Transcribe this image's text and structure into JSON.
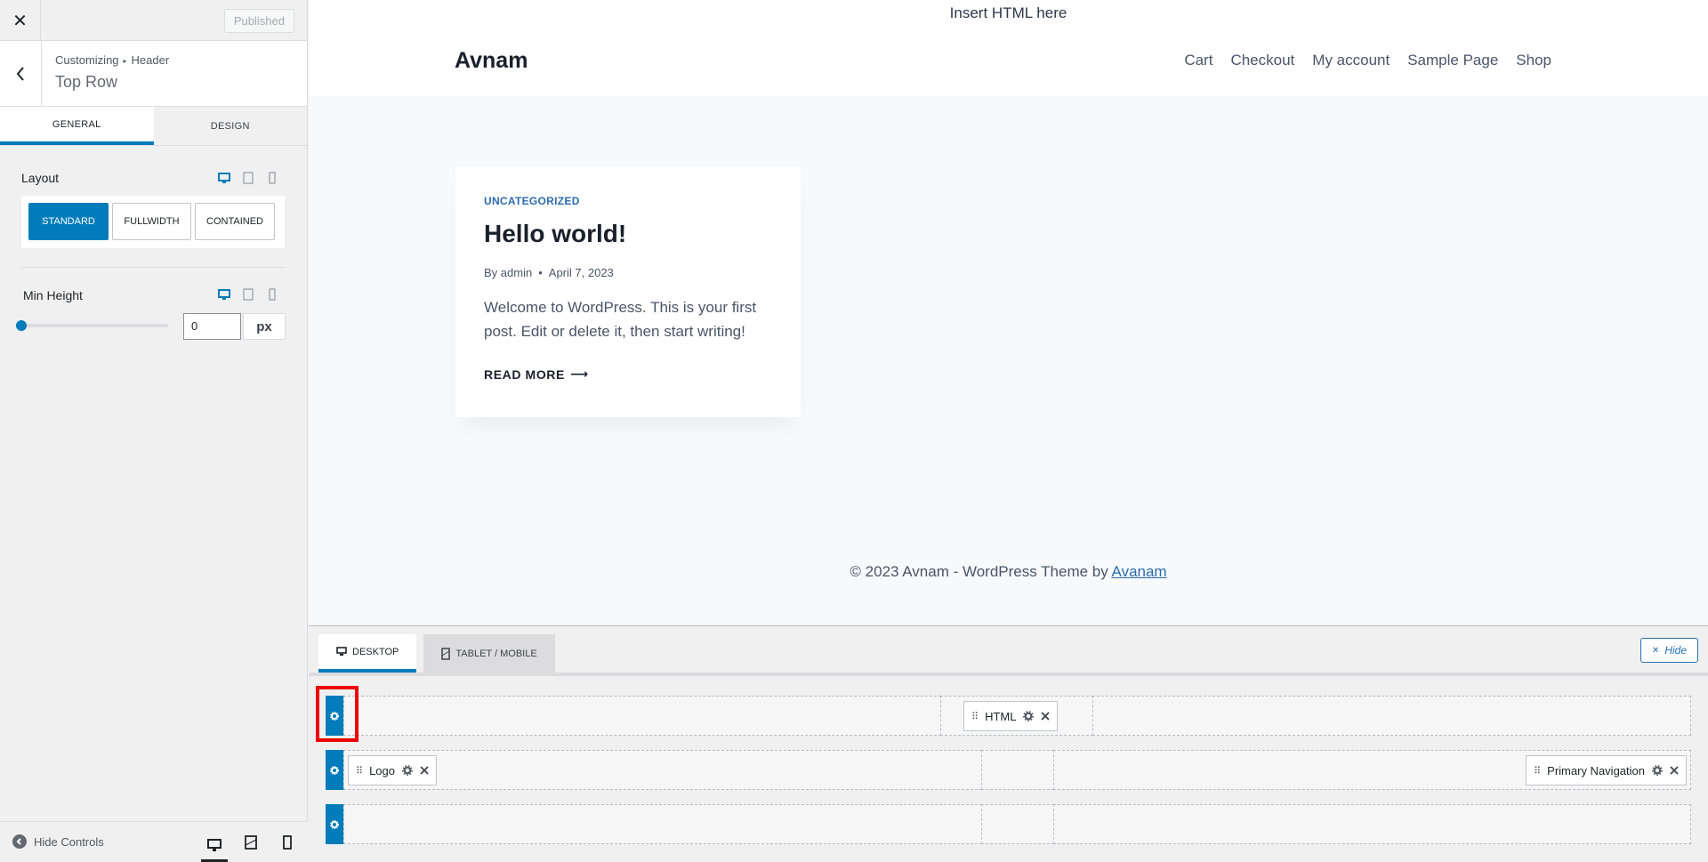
{
  "panel": {
    "close_label": "✕",
    "publish_label": "Published",
    "breadcrumb": {
      "root": "Customizing",
      "separator": "▸",
      "section": "Header"
    },
    "section_title": "Top Row",
    "tabs": [
      {
        "label": "GENERAL"
      },
      {
        "label": "DESIGN"
      }
    ],
    "layout": {
      "label": "Layout",
      "options": [
        {
          "label": "STANDARD"
        },
        {
          "label": "FULLWIDTH"
        },
        {
          "label": "CONTAINED"
        }
      ],
      "selected": "STANDARD"
    },
    "min_height": {
      "label": "Min Height",
      "value": "0",
      "unit": "px",
      "slider_fraction": 0
    },
    "footer": {
      "hide_controls_label": "Hide Controls",
      "active_device": "desktop"
    }
  },
  "preview": {
    "top_html": "Insert HTML here",
    "logo": "Avnam",
    "nav": [
      {
        "label": "Cart"
      },
      {
        "label": "Checkout"
      },
      {
        "label": "My account"
      },
      {
        "label": "Sample Page"
      },
      {
        "label": "Shop"
      }
    ],
    "post": {
      "category": "UNCATEGORIZED",
      "title": "Hello world!",
      "author_prefix": "By",
      "author": "admin",
      "meta_sep": "•",
      "date": "April 7, 2023",
      "excerpt": "Welcome to WordPress. This is your first post. Edit or delete it, then start writing!",
      "read_more": "READ MORE",
      "read_more_arrow": "⟶"
    },
    "footer": {
      "text": "© 2023 Avnam - WordPress Theme by",
      "link": "Avanam"
    }
  },
  "builder": {
    "tabs": [
      {
        "label": "DESKTOP"
      },
      {
        "label": "TABLET / MOBILE"
      }
    ],
    "hide_label": "Hide",
    "rows": {
      "top": {
        "items": [
          {
            "label": "HTML"
          }
        ]
      },
      "main": {
        "items": [
          {
            "label": "Logo"
          },
          {
            "label": "Primary Navigation"
          }
        ]
      },
      "bottom": {
        "items": []
      }
    }
  },
  "colors": {
    "accent": "#007cba",
    "highlight": "#e00000",
    "link": "#2b6cb0"
  },
  "icons": [
    "close-icon",
    "back-chevron-icon",
    "desktop-icon",
    "tablet-icon",
    "mobile-icon",
    "gear-icon",
    "drag-handle-icon",
    "x-icon",
    "arrow-left-circle-icon"
  ]
}
